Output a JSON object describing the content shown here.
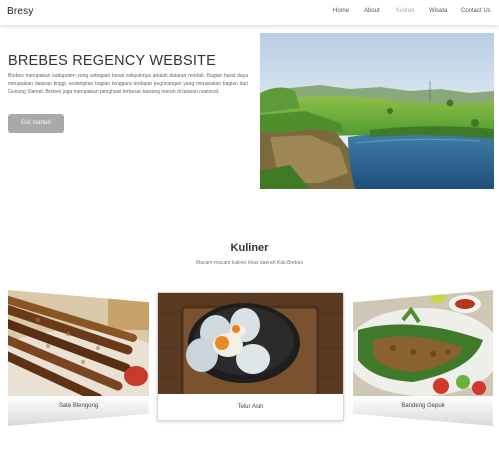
{
  "navbar": {
    "brand": "Bresy",
    "items": [
      {
        "label": "Home",
        "active": false
      },
      {
        "label": "About",
        "active": false
      },
      {
        "label": "Kuliner",
        "active": true
      },
      {
        "label": "Wisata",
        "active": false
      },
      {
        "label": "Contact Us",
        "active": false
      }
    ]
  },
  "hero": {
    "title": "BREBES REGENCY WEBSITE",
    "description": "Brebes merupakan kabupaten yang sebagian besar wilayahnya adalah dataran rendah. Bagian barat daya merupakan dataran tinggi, sedangkan bagian tenggara terdapat pegunungan yang merupakan bagian dari Gunung Slamet. Brebes juga merupakan penghasil terbesar bawang merah di tataran nasional.",
    "button_label": "Get started"
  },
  "kuliner": {
    "title": "Kuliner",
    "subtitle": "Macam-macam kuliner khas daerah Kab.Brebes",
    "cards": [
      {
        "caption": "Sate Blengong"
      },
      {
        "caption": "Telur Asin"
      },
      {
        "caption": "Bandeng Gepuk"
      }
    ]
  },
  "colors": {
    "button_bg": "#a9a9a9",
    "active_nav": "#aaaaaa",
    "text_dark": "#333333"
  }
}
